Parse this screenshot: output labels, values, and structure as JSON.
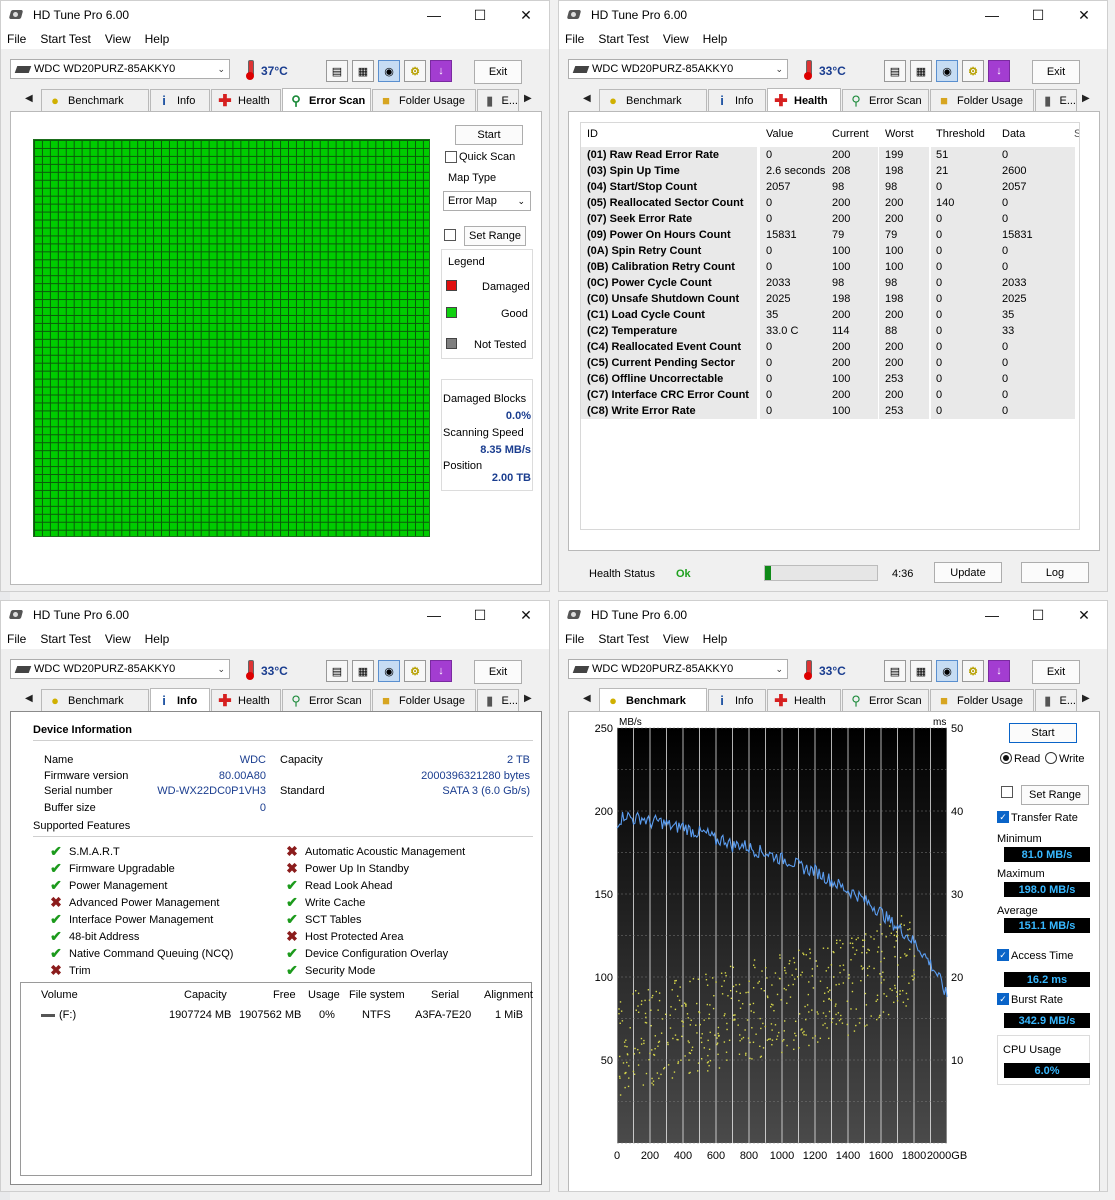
{
  "app_title": "HD Tune Pro 6.00",
  "menu": [
    "File",
    "Start Test",
    "View",
    "Help"
  ],
  "drive": "WDC WD20PURZ-85AKKY0",
  "exit_label": "Exit",
  "tabs": {
    "benchmark": "Benchmark",
    "info": "Info",
    "health": "Health",
    "error_scan": "Error Scan",
    "folder_usage": "Folder Usage",
    "erase": "E..."
  },
  "windows": {
    "error_scan": {
      "temperature": "37°C",
      "start": "Start",
      "quick_scan": "Quick Scan",
      "map_type_label": "Map Type",
      "map_type_value": "Error Map",
      "set_range": "Set Range",
      "legend_title": "Legend",
      "legend": [
        {
          "label": "Damaged",
          "color": "#e01010"
        },
        {
          "label": "Good",
          "color": "#10d010"
        },
        {
          "label": "Not Tested",
          "color": "#808080"
        }
      ],
      "damaged_blocks_label": "Damaged Blocks",
      "damaged_blocks": "0.0%",
      "scanning_speed_label": "Scanning Speed",
      "scanning_speed": "8.35 MB/s",
      "position_label": "Position",
      "position": "2.00 TB"
    },
    "health": {
      "temperature": "33°C",
      "columns": [
        "ID",
        "Value",
        "Current",
        "Worst",
        "Threshold",
        "Data",
        "S"
      ],
      "rows": [
        [
          "(01) Raw Read Error Rate",
          "0",
          "200",
          "199",
          "51",
          "0"
        ],
        [
          "(03) Spin Up Time",
          "2.6 seconds",
          "208",
          "198",
          "21",
          "2600"
        ],
        [
          "(04) Start/Stop Count",
          "2057",
          "98",
          "98",
          "0",
          "2057"
        ],
        [
          "(05) Reallocated Sector Count",
          "0",
          "200",
          "200",
          "140",
          "0"
        ],
        [
          "(07) Seek Error Rate",
          "0",
          "200",
          "200",
          "0",
          "0"
        ],
        [
          "(09) Power On Hours Count",
          "15831",
          "79",
          "79",
          "0",
          "15831"
        ],
        [
          "(0A) Spin Retry Count",
          "0",
          "100",
          "100",
          "0",
          "0"
        ],
        [
          "(0B) Calibration Retry Count",
          "0",
          "100",
          "100",
          "0",
          "0"
        ],
        [
          "(0C) Power Cycle Count",
          "2033",
          "98",
          "98",
          "0",
          "2033"
        ],
        [
          "(C0) Unsafe Shutdown Count",
          "2025",
          "198",
          "198",
          "0",
          "2025"
        ],
        [
          "(C1) Load Cycle Count",
          "35",
          "200",
          "200",
          "0",
          "35"
        ],
        [
          "(C2) Temperature",
          "33.0 C",
          "114",
          "88",
          "0",
          "33"
        ],
        [
          "(C4) Reallocated Event Count",
          "0",
          "200",
          "200",
          "0",
          "0"
        ],
        [
          "(C5) Current Pending Sector",
          "0",
          "200",
          "200",
          "0",
          "0"
        ],
        [
          "(C6) Offline Uncorrectable",
          "0",
          "100",
          "253",
          "0",
          "0"
        ],
        [
          "(C7) Interface CRC Error Count",
          "0",
          "200",
          "200",
          "0",
          "0"
        ],
        [
          "(C8) Write Error Rate",
          "0",
          "100",
          "253",
          "0",
          "0"
        ]
      ],
      "status_label": "Health Status",
      "status": "Ok",
      "status_color": "#1ea01e",
      "refresh_progress": 0.05,
      "timer": "4:36",
      "update": "Update",
      "log": "Log"
    },
    "info": {
      "temperature": "33°C",
      "device_info_title": "Device Information",
      "name_label": "Name",
      "name": "WDC",
      "firmware_label": "Firmware version",
      "firmware": "80.00A80",
      "serial_label": "Serial number",
      "serial": "WD-WX22DC0P1VH3",
      "buffer_label": "Buffer size",
      "buffer": "0",
      "capacity_label": "Capacity",
      "capacity": "2 TB",
      "capacity_bytes": "2000396321280 bytes",
      "standard_label": "Standard",
      "standard": "SATA 3 (6.0 Gb/s)",
      "supported_features_title": "Supported Features",
      "features_left": [
        {
          "label": "S.M.A.R.T",
          "supported": true
        },
        {
          "label": "Firmware Upgradable",
          "supported": true
        },
        {
          "label": "Power Management",
          "supported": true
        },
        {
          "label": "Advanced Power Management",
          "supported": false
        },
        {
          "label": "Interface Power Management",
          "supported": true
        },
        {
          "label": "48-bit Address",
          "supported": true
        },
        {
          "label": "Native Command Queuing (NCQ)",
          "supported": true
        },
        {
          "label": "Trim",
          "supported": false
        }
      ],
      "features_right": [
        {
          "label": "Automatic Acoustic Management",
          "supported": false
        },
        {
          "label": "Power Up In Standby",
          "supported": false
        },
        {
          "label": "Read Look Ahead",
          "supported": true
        },
        {
          "label": "Write Cache",
          "supported": true
        },
        {
          "label": "SCT Tables",
          "supported": true
        },
        {
          "label": "Host Protected Area",
          "supported": false
        },
        {
          "label": "Device Configuration Overlay",
          "supported": true
        },
        {
          "label": "Security Mode",
          "supported": true
        }
      ],
      "volume_columns": [
        "Volume",
        "Capacity",
        "Free",
        "Usage",
        "File system",
        "Serial",
        "Alignment"
      ],
      "volumes": [
        [
          "(F:)",
          "1907724 MB",
          "1907562 MB",
          "0%",
          "NTFS",
          "A3FA-7E20",
          "1 MiB"
        ]
      ]
    },
    "benchmark": {
      "temperature": "33°C",
      "start": "Start",
      "read": "Read",
      "write": "Write",
      "set_range": "Set Range",
      "transfer_rate": "Transfer Rate",
      "minimum_label": "Minimum",
      "minimum": "81.0 MB/s",
      "maximum_label": "Maximum",
      "maximum": "198.0 MB/s",
      "average_label": "Average",
      "average": "151.1 MB/s",
      "access_time_label": "Access Time",
      "access_time": "16.2 ms",
      "burst_rate_label": "Burst Rate",
      "burst_rate": "342.9 MB/s",
      "cpu_usage_label": "CPU Usage",
      "cpu_usage": "6.0%"
    }
  },
  "chart_data": {
    "type": "line",
    "ylabel": "MB/s",
    "y2label": "ms",
    "x_unit": "GB",
    "xlim": [
      0,
      2000
    ],
    "ylim": [
      0,
      250
    ],
    "y2lim": [
      0,
      50
    ],
    "x_ticks": [
      0,
      200,
      400,
      600,
      800,
      1000,
      1200,
      1400,
      1600,
      1800,
      2000
    ],
    "y_ticks": [
      50,
      100,
      150,
      200,
      250
    ],
    "y2_ticks": [
      10,
      20,
      30,
      40,
      50
    ],
    "grid": true,
    "series": [
      {
        "name": "Transfer Rate",
        "color": "#5b9df0",
        "x": [
          0,
          50,
          100,
          150,
          200,
          250,
          300,
          350,
          400,
          450,
          500,
          550,
          600,
          650,
          700,
          750,
          800,
          850,
          900,
          950,
          1000,
          1050,
          1100,
          1150,
          1200,
          1250,
          1300,
          1350,
          1400,
          1450,
          1500,
          1550,
          1600,
          1650,
          1700,
          1750,
          1800,
          1850,
          1900,
          1950,
          2000
        ],
        "y": [
          193,
          198,
          195,
          196,
          193,
          194,
          192,
          190,
          191,
          188,
          187,
          186,
          182,
          183,
          179,
          180,
          178,
          176,
          175,
          173,
          171,
          170,
          167,
          165,
          164,
          161,
          158,
          155,
          152,
          150,
          146,
          143,
          139,
          134,
          130,
          126,
          121,
          115,
          108,
          100,
          88
        ]
      },
      {
        "name": "Access Time",
        "color": "#d8d84a",
        "type": "scatter",
        "x": [
          0,
          100,
          200,
          300,
          400,
          500,
          600,
          700,
          800,
          900,
          1000,
          1100,
          1200,
          1300,
          1400,
          1500,
          1600,
          1700,
          1800
        ],
        "y": [
          11,
          12.5,
          13,
          13.5,
          14,
          14.5,
          15,
          15.5,
          16,
          16.5,
          17,
          17.5,
          18,
          18.5,
          19,
          20,
          21,
          22,
          23
        ]
      }
    ]
  }
}
